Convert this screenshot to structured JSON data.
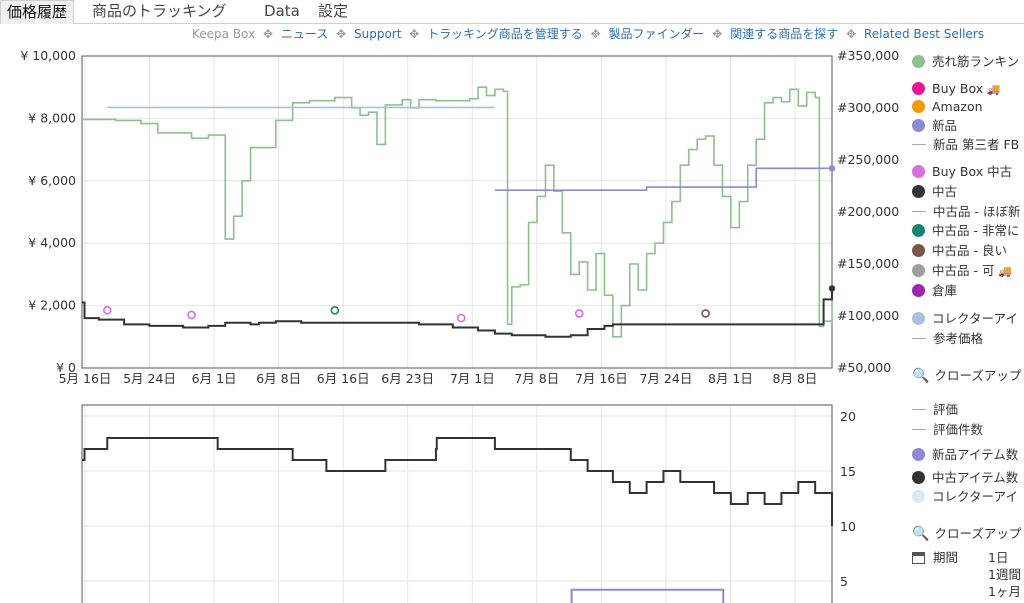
{
  "tabs": [
    "価格履歴",
    "商品のトラッキング",
    "Data",
    "設定"
  ],
  "links": {
    "keepa_box": "Keepa Box",
    "items": [
      "ニュース",
      "Support",
      "トラッキング商品を管理する",
      "製品ファインダー",
      "関連する商品を探す",
      "Related Best Sellers"
    ]
  },
  "legend": {
    "price": [
      {
        "label": "売れ筋ランキン",
        "kind": "dot",
        "color": "#8fbf8f"
      },
      {
        "label": "Buy Box",
        "kind": "dot",
        "color": "#e8129a",
        "truck": true
      },
      {
        "label": "Amazon",
        "kind": "dot",
        "color": "#f29a00"
      },
      {
        "label": "新品",
        "kind": "dot",
        "color": "#8a8ad6"
      },
      {
        "label": "新品 第三者 FB",
        "kind": "dash",
        "color": "#aaaaaa"
      },
      {
        "label": "Buy Box 中古",
        "kind": "dot",
        "color": "#d86ee0"
      },
      {
        "label": "中古",
        "kind": "dot",
        "color": "#333333"
      },
      {
        "label": "中古品 - ほぼ新",
        "kind": "dash",
        "color": "#aaaaaa"
      },
      {
        "label": "中古品 - 非常に",
        "kind": "dot",
        "color": "#16856f"
      },
      {
        "label": "中古品 - 良い",
        "kind": "dot",
        "color": "#7c5549"
      },
      {
        "label": "中古品 - 可",
        "kind": "dot",
        "color": "#9e9e9e",
        "truck": true
      },
      {
        "label": "倉庫",
        "kind": "dot",
        "color": "#9c27b0"
      },
      {
        "label": "コレクターアイ",
        "kind": "dot",
        "color": "#a9c0d9"
      },
      {
        "label": "参考価格",
        "kind": "dash",
        "color": "#aaaaaa"
      }
    ],
    "closeup": "クローズアップ",
    "bottom": [
      {
        "label": "評価",
        "kind": "dash",
        "color": "#aaaaaa"
      },
      {
        "label": "評価件数",
        "kind": "dash",
        "color": "#aaaaaa"
      },
      {
        "label": "新品アイテム数",
        "kind": "dot",
        "color": "#8a8ad6"
      },
      {
        "label": "中古アイテム数",
        "kind": "dot",
        "color": "#333333"
      },
      {
        "label": "コレクターアイ",
        "kind": "dot",
        "color": "#dde7f5"
      }
    ],
    "closeup2": "クローズアップ",
    "period_label": "期間",
    "periods": [
      "1日",
      "1週間",
      "1ヶ月"
    ]
  },
  "chart_data": [
    {
      "type": "line",
      "title": "",
      "x_ticks": [
        "5月 16日",
        "5月 24日",
        "6月 1日",
        "6月 8日",
        "6月 16日",
        "6月 23日",
        "7月 1日",
        "7月 8日",
        "7月 16日",
        "7月 24日",
        "8月 1日",
        "8月 8日"
      ],
      "y_left": {
        "ticks": [
          "¥ 0",
          "¥ 2,000",
          "¥ 4,000",
          "¥ 6,000",
          "¥ 8,000",
          "¥ 10,000"
        ],
        "ylim": [
          0,
          10000
        ]
      },
      "y_right": {
        "ticks": [
          "#50,000",
          "#100,000",
          "#150,000",
          "#200,000",
          "#250,000",
          "#300,000",
          "#350,000"
        ],
        "ylim": [
          50000,
          350000
        ]
      },
      "x_range": [
        0,
        89
      ],
      "series": [
        {
          "name": "売れ筋ランキン",
          "axis": "right",
          "color": "#8fbf8f",
          "points": [
            [
              0,
              289000
            ],
            [
              4,
              288000
            ],
            [
              7,
              285000
            ],
            [
              9,
              276000
            ],
            [
              13,
              271000
            ],
            [
              15,
              274000
            ],
            [
              16,
              274000
            ],
            [
              17,
              174000
            ],
            [
              18,
              196000
            ],
            [
              19,
              230000
            ],
            [
              20,
              262000
            ],
            [
              23,
              288000
            ],
            [
              25,
              305000
            ],
            [
              27,
              307000
            ],
            [
              30,
              310000
            ],
            [
              32,
              300000
            ],
            [
              33,
              293000
            ],
            [
              34,
              296000
            ],
            [
              35,
              265000
            ],
            [
              36,
              303000
            ],
            [
              38,
              308000
            ],
            [
              39,
              300000
            ],
            [
              40,
              308000
            ],
            [
              42,
              307000
            ],
            [
              46,
              309000
            ],
            [
              47,
              320000
            ],
            [
              48,
              312000
            ],
            [
              49,
              318000
            ],
            [
              50,
              316000
            ],
            [
              50.5,
              92000
            ],
            [
              51,
              128000
            ],
            [
              52,
              130000
            ],
            [
              53,
              190000
            ],
            [
              54,
              215000
            ],
            [
              55,
              245000
            ],
            [
              56,
              220000
            ],
            [
              57,
              180000
            ],
            [
              58,
              140000
            ],
            [
              59,
              152000
            ],
            [
              60,
              125000
            ],
            [
              61,
              160000
            ],
            [
              62,
              120000
            ],
            [
              63,
              80000
            ],
            [
              64,
              110000
            ],
            [
              65,
              150000
            ],
            [
              66,
              125000
            ],
            [
              67,
              160000
            ],
            [
              68,
              170000
            ],
            [
              69,
              190000
            ],
            [
              70,
              210000
            ],
            [
              71,
              245000
            ],
            [
              72,
              260000
            ],
            [
              73,
              270000
            ],
            [
              74,
              273000
            ],
            [
              75,
              245000
            ],
            [
              76,
              215000
            ],
            [
              77,
              185000
            ],
            [
              78,
              210000
            ],
            [
              79,
              245000
            ],
            [
              80,
              270000
            ],
            [
              81,
              305000
            ],
            [
              82,
              310000
            ],
            [
              83,
              306000
            ],
            [
              84,
              318000
            ],
            [
              85,
              302000
            ],
            [
              86,
              315000
            ],
            [
              87,
              310000
            ],
            [
              87.5,
              90000
            ],
            [
              88,
              95000
            ],
            [
              89,
              115000
            ]
          ]
        },
        {
          "name": "中古",
          "axis": "left",
          "color": "#333333",
          "points": [
            [
              0,
              2100
            ],
            [
              0.3,
              1600
            ],
            [
              2,
              1550
            ],
            [
              5,
              1400
            ],
            [
              8,
              1350
            ],
            [
              12,
              1300
            ],
            [
              15,
              1350
            ],
            [
              17,
              1450
            ],
            [
              20,
              1400
            ],
            [
              21,
              1450
            ],
            [
              23,
              1500
            ],
            [
              26,
              1450
            ],
            [
              30,
              1450
            ],
            [
              40,
              1400
            ],
            [
              44,
              1300
            ],
            [
              47,
              1200
            ],
            [
              49,
              1100
            ],
            [
              51,
              1050
            ],
            [
              55,
              1000
            ],
            [
              58,
              1050
            ],
            [
              60,
              1250
            ],
            [
              62,
              1350
            ],
            [
              63,
              1400
            ],
            [
              70,
              1400
            ],
            [
              75,
              1400
            ],
            [
              80,
              1400
            ],
            [
              85,
              1400
            ],
            [
              87,
              1400
            ],
            [
              88,
              2200
            ],
            [
              89,
              2550
            ]
          ]
        },
        {
          "name": "新品",
          "axis": "left",
          "color": "#8a8ad6",
          "points": [
            [
              49,
              5700
            ],
            [
              62,
              5700
            ],
            [
              67,
              5800
            ],
            [
              72,
              5800
            ],
            [
              80,
              6400
            ],
            [
              84,
              6400
            ],
            [
              89,
              6400
            ]
          ]
        },
        {
          "name": "参考価格",
          "axis": "left",
          "color": "#a9c0d9",
          "points": [
            [
              3,
              8350
            ],
            [
              49,
              8350
            ]
          ]
        },
        {
          "name": "Buy Box 中古",
          "axis": "left",
          "color": "#d86ee0",
          "kind": "markers",
          "points": [
            [
              3,
              1850
            ],
            [
              13,
              1700
            ],
            [
              45,
              1600
            ],
            [
              59,
              1750
            ]
          ]
        },
        {
          "name": "中古品 - 非常に",
          "axis": "left",
          "color": "#16856f",
          "kind": "markers",
          "points": [
            [
              30,
              1850
            ]
          ]
        },
        {
          "name": "中古品 - 良い",
          "axis": "left",
          "color": "#7c5549",
          "kind": "markers",
          "points": [
            [
              74,
              1750
            ]
          ]
        }
      ]
    },
    {
      "type": "line",
      "title": "",
      "y_right": {
        "ticks": [
          "5",
          "10",
          "15",
          "20"
        ],
        "ylim": [
          3,
          21
        ]
      },
      "x_range": [
        0,
        89
      ],
      "series": [
        {
          "name": "中古アイテム数",
          "color": "#333333",
          "points": [
            [
              0,
              16
            ],
            [
              0.3,
              17
            ],
            [
              3,
              18
            ],
            [
              16,
              18
            ],
            [
              16.1,
              17
            ],
            [
              25,
              16
            ],
            [
              29,
              15
            ],
            [
              36,
              16
            ],
            [
              42,
              17
            ],
            [
              42.1,
              18
            ],
            [
              49,
              17
            ],
            [
              54,
              17
            ],
            [
              58,
              16
            ],
            [
              60,
              15
            ],
            [
              63,
              14
            ],
            [
              65,
              13
            ],
            [
              67,
              14
            ],
            [
              69,
              15
            ],
            [
              71,
              14
            ],
            [
              75,
              13
            ],
            [
              77,
              12
            ],
            [
              79,
              13
            ],
            [
              81,
              12
            ],
            [
              83,
              13
            ],
            [
              85,
              14
            ],
            [
              87,
              13
            ],
            [
              89,
              10
            ]
          ]
        },
        {
          "name": "新品アイテム数",
          "color": "#8a8ad6",
          "points": [
            [
              58,
              3
            ],
            [
              58.1,
              4.2
            ],
            [
              76,
              4.2
            ],
            [
              76.1,
              3
            ]
          ]
        }
      ]
    }
  ]
}
